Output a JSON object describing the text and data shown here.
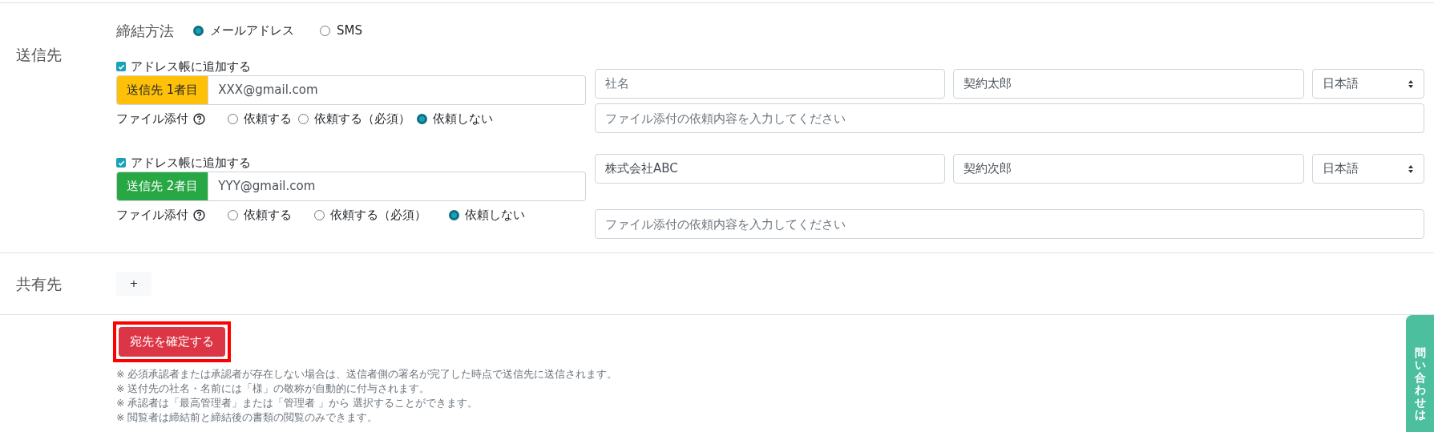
{
  "recipients_section": {
    "label": "送信先",
    "method": {
      "label": "締結方法",
      "options": [
        {
          "label": "メールアドレス",
          "selected": true
        },
        {
          "label": "SMS",
          "selected": false
        }
      ]
    },
    "recipients": [
      {
        "address_book": {
          "label": "アドレス帳に追加する",
          "checked": true
        },
        "badge": {
          "label": "送信先 1者目",
          "kind": "warning"
        },
        "email": "XXX@gmail.com",
        "attachment": {
          "label": "ファイル添付",
          "options": [
            {
              "label": "依頼する",
              "selected": false
            },
            {
              "label": "依頼する（必須）",
              "selected": false
            },
            {
              "label": "依頼しない",
              "selected": true
            }
          ]
        },
        "company": {
          "placeholder": "社名"
        },
        "name": "契約太郎",
        "language": "日本語",
        "request_placeholder": "ファイル添付の依頼内容を入力してください"
      },
      {
        "address_book": {
          "label": "アドレス帳に追加する",
          "checked": true
        },
        "badge": {
          "label": "送信先 2者目",
          "kind": "success"
        },
        "email": "YYY@gmail.com",
        "attachment": {
          "label": "ファイル添付",
          "options": [
            {
              "label": "依頼する",
              "selected": false
            },
            {
              "label": "依頼する（必須）",
              "selected": false
            },
            {
              "label": "依頼しない",
              "selected": true
            }
          ]
        },
        "company": {
          "value": "株式会社ABC"
        },
        "name": "契約次郎",
        "language": "日本語",
        "request_placeholder": "ファイル添付の依頼内容を入力してください"
      }
    ]
  },
  "share_section": {
    "label": "共有先",
    "add_button": "+"
  },
  "confirm_button": "宛先を確定する",
  "notes": [
    "※ 必須承認者または承認者が存在しない場合は、送信者側の署名が完了した時点で送信先に送信されます。",
    "※ 送付先の社名・名前には「様」の敬称が自動的に付与されます。",
    "※ 承認者は「最高管理者」または「管理者 」から 選択することができます。",
    "※ 閲覧者は締結前と締結後の書類の閲覧のみできます。"
  ],
  "side_tab": "問い合わせは"
}
